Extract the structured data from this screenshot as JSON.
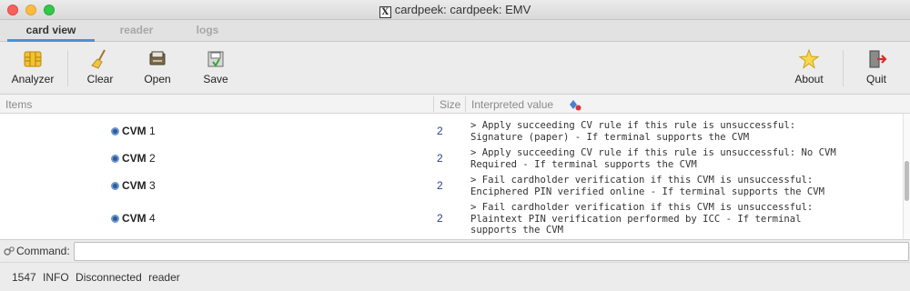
{
  "window": {
    "title": "cardpeek: cardpeek: EMV"
  },
  "tabs": [
    {
      "label": "card view",
      "active": true
    },
    {
      "label": "reader",
      "active": false
    },
    {
      "label": "logs",
      "active": false
    }
  ],
  "toolbar": {
    "analyzer_label": "Analyzer",
    "clear_label": "Clear",
    "open_label": "Open",
    "save_label": "Save",
    "about_label": "About",
    "quit_label": "Quit"
  },
  "table": {
    "headers": {
      "items": "Items",
      "size": "Size",
      "interpreted": "Interpreted value"
    },
    "rows": [
      {
        "name": "CVM",
        "index": "1",
        "size": "2",
        "value": "> Apply succeeding CV rule if this rule is unsuccessful:\nSignature (paper) - If terminal supports the CVM"
      },
      {
        "name": "CVM",
        "index": "2",
        "size": "2",
        "value": "> Apply succeeding CV rule if this rule is unsuccessful: No CVM\nRequired - If terminal supports the CVM"
      },
      {
        "name": "CVM",
        "index": "3",
        "size": "2",
        "value": "> Fail cardholder verification if this CVM is unsuccessful:\nEnciphered PIN verified online - If terminal supports the CVM"
      },
      {
        "name": "CVM",
        "index": "4",
        "size": "2",
        "value": "> Fail cardholder verification if this CVM is unsuccessful:\nPlaintext PIN verification performed by ICC - If terminal\nsupports the CVM"
      }
    ]
  },
  "command": {
    "label": "Command:",
    "value": ""
  },
  "status": {
    "text": "1547 INFO  Disconnected reader"
  },
  "colors": {
    "accent": "#4a90d9",
    "size_text": "#2a3f8f"
  }
}
